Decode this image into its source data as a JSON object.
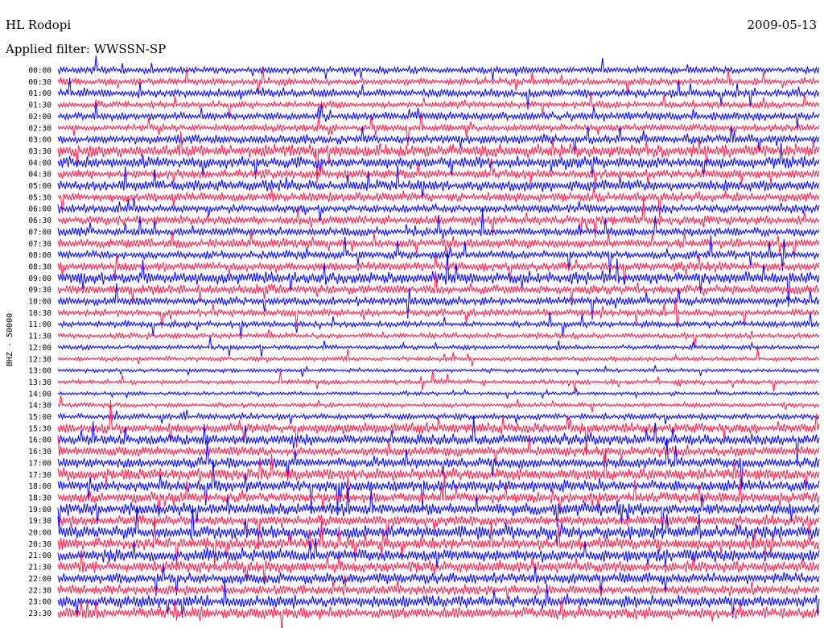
{
  "header": {
    "station": "HL Rodopi",
    "date": "2009-05-13",
    "filter_prefix": "Applied filter:",
    "filter_name": "WWSSN-SP"
  },
  "chart_data": {
    "type": "line",
    "plot_kind": "helicorder",
    "station": "HL Rodopi",
    "channel_label": "BHZ - 50000",
    "date": "2009-05-13",
    "filter": "WWSSN-SP",
    "rows": [
      "00:00",
      "00:30",
      "01:00",
      "01:30",
      "02:00",
      "02:30",
      "03:00",
      "03:30",
      "04:00",
      "04:30",
      "05:00",
      "05:30",
      "06:00",
      "06:30",
      "07:00",
      "07:30",
      "08:00",
      "08:30",
      "09:00",
      "09:30",
      "10:00",
      "10:30",
      "11:00",
      "11:30",
      "12:00",
      "12:30",
      "13:00",
      "13:30",
      "14:00",
      "14:30",
      "15:00",
      "15:30",
      "16:00",
      "16:30",
      "17:00",
      "17:30",
      "18:00",
      "18:30",
      "19:00",
      "19:30",
      "20:00",
      "20:30",
      "21:00",
      "21:30",
      "22:00",
      "22:30",
      "23:00",
      "23:30"
    ],
    "row_minutes": 30,
    "trace_colors": [
      "#0000ff",
      "#ff1a4a"
    ],
    "amplitude_profile": [
      0.45,
      0.45,
      0.55,
      0.45,
      0.55,
      0.45,
      0.6,
      0.85,
      0.75,
      0.6,
      0.7,
      0.6,
      0.55,
      0.6,
      0.55,
      0.6,
      0.55,
      0.6,
      0.8,
      0.6,
      0.55,
      0.45,
      0.4,
      0.35,
      0.3,
      0.3,
      0.25,
      0.3,
      0.25,
      0.3,
      0.4,
      0.7,
      0.7,
      0.65,
      0.7,
      0.8,
      0.75,
      0.7,
      0.8,
      0.7,
      0.9,
      0.8,
      0.8,
      0.75,
      0.7,
      0.65,
      0.8,
      0.75
    ],
    "grid": false
  }
}
